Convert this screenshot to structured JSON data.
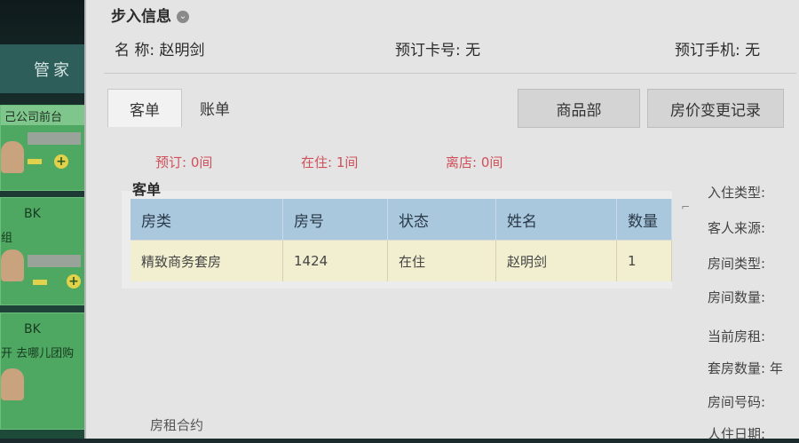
{
  "sidebar": {
    "header": "管家",
    "cards": [
      {
        "top": "己公司前台",
        "code": "",
        "sub": ""
      },
      {
        "top": "",
        "code": "BK",
        "sub": "组"
      },
      {
        "top": "",
        "code": "BK",
        "sub": "开 去哪儿团购"
      }
    ]
  },
  "dialog": {
    "title": "步入信息",
    "name_label": "名 称: 赵明剑",
    "card_label": "预订卡号: 无",
    "phone_label": "预订手机: 无"
  },
  "tabs": [
    {
      "label": "客单"
    },
    {
      "label": "账单"
    },
    {
      "label": "商品部"
    },
    {
      "label": "房价变更记录"
    }
  ],
  "summary": {
    "booked": "预订: 0间",
    "in_house": "在住: 1间",
    "checked_out": "离店: 0间"
  },
  "guest_section": {
    "title": "客单",
    "columns": [
      "房类",
      "房号",
      "状态",
      "姓名",
      "数量"
    ],
    "rows": [
      [
        "精致商务套房",
        "1424",
        "在住",
        "赵明剑",
        "1"
      ]
    ]
  },
  "right_fields": [
    "入住类型:",
    "客人来源:",
    "房间类型:",
    "房间数量:",
    "当前房租:",
    "套房数量: 年",
    "房间号码:",
    "人住日期:"
  ],
  "bottom": {
    "contract_label": "房租合约"
  },
  "colors": {
    "table_header": "#a9c7dd",
    "row_highlight": "#f2efd0",
    "summary_text": "#d0505a"
  }
}
